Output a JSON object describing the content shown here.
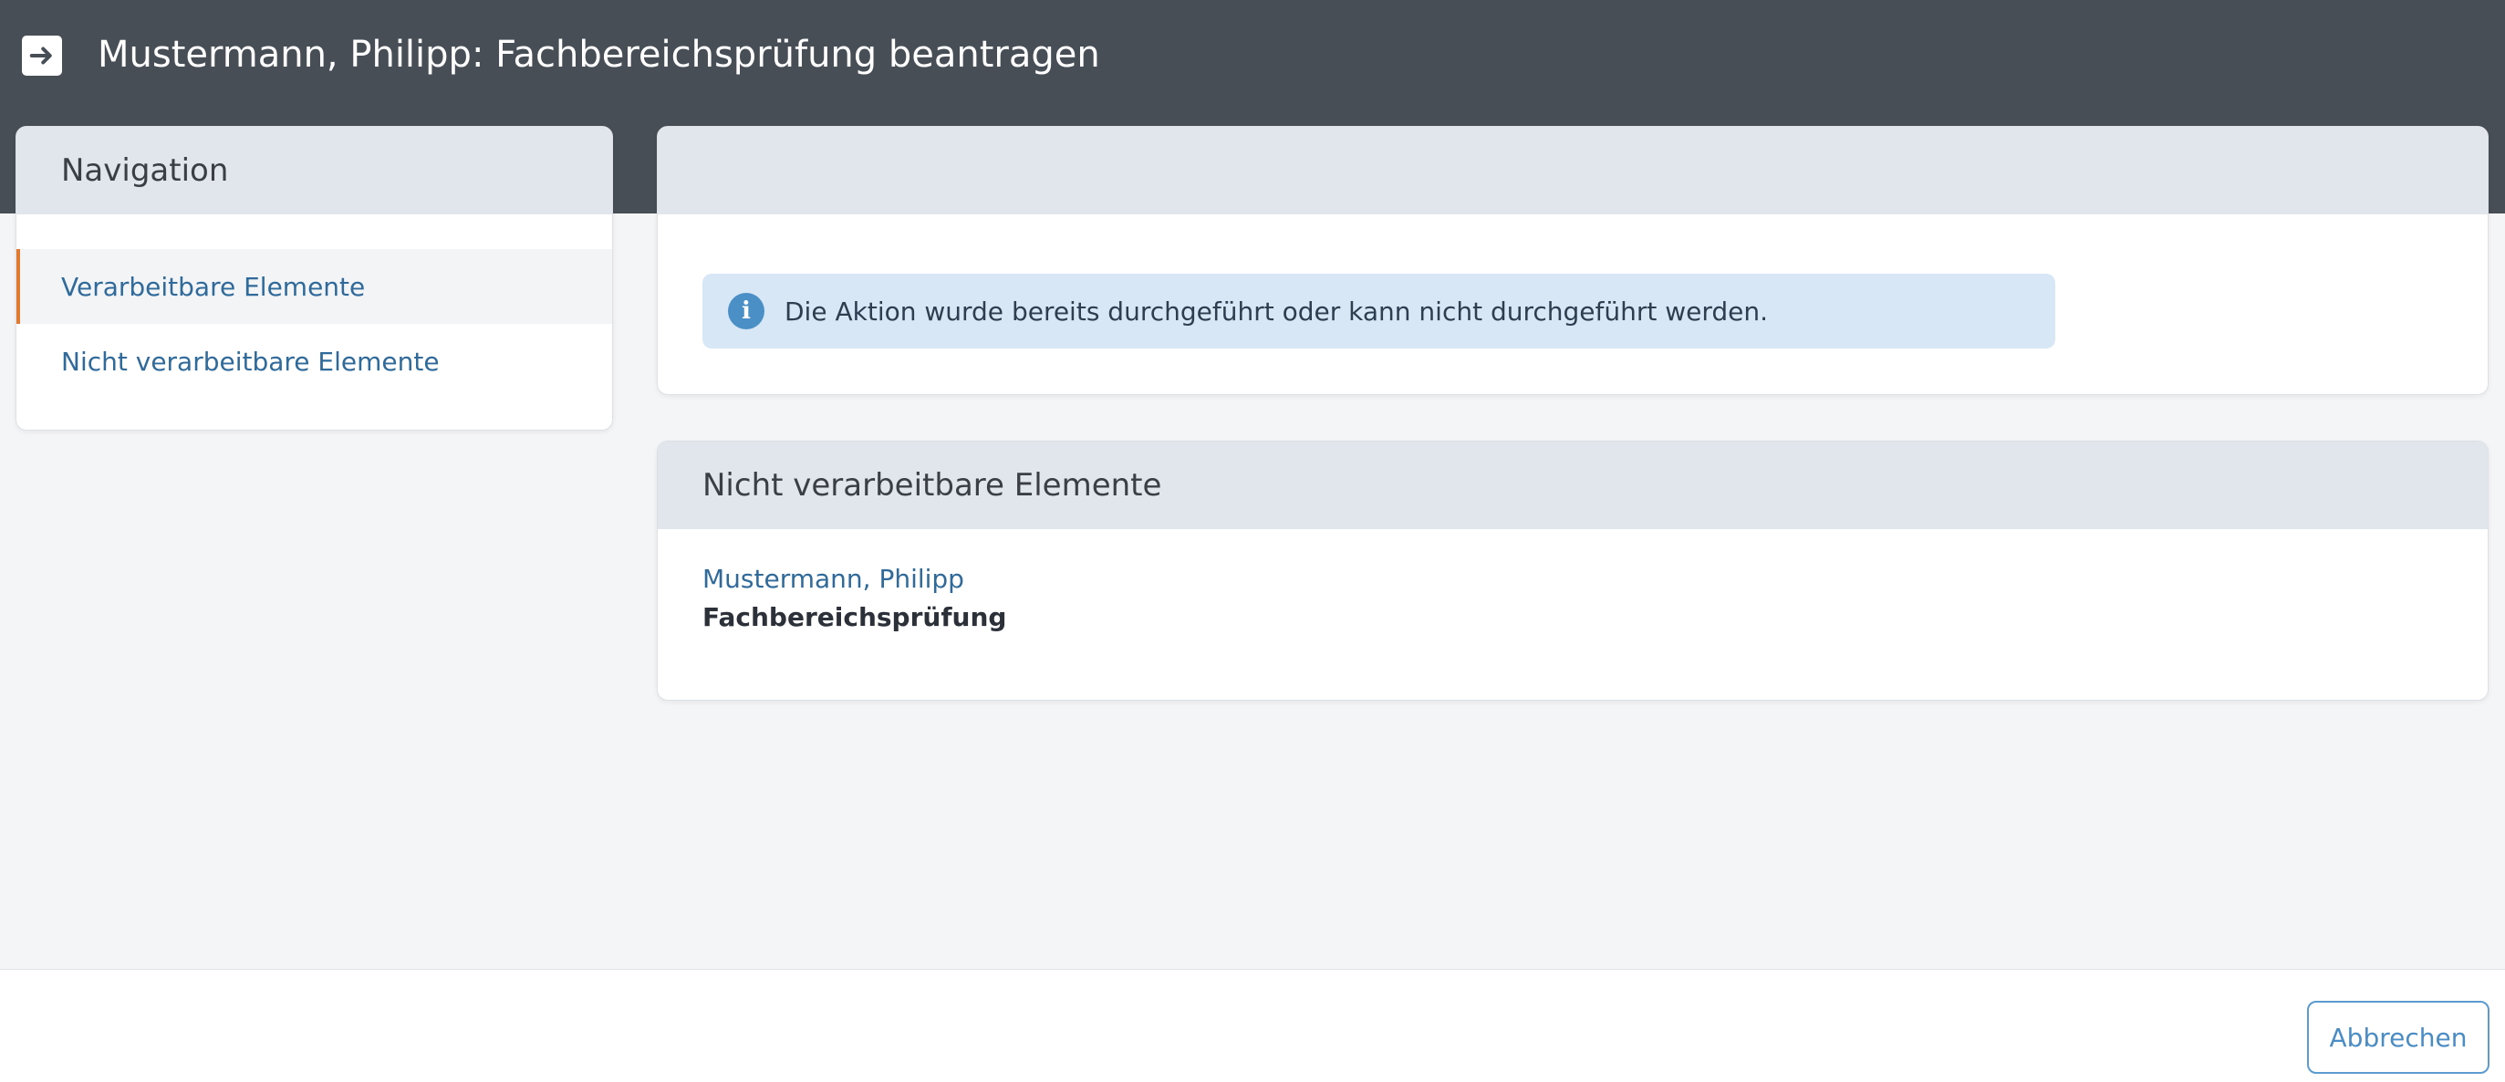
{
  "header": {
    "title": "Mustermann, Philipp: Fachbereichsprüfung beantragen",
    "icon": "arrow-right-icon"
  },
  "navigation": {
    "heading": "Navigation",
    "items": [
      {
        "label": "Verarbeitbare Elemente",
        "active": true
      },
      {
        "label": "Nicht verarbeitbare Elemente",
        "active": false
      }
    ]
  },
  "action_panel": {
    "heading": "",
    "alert": {
      "icon": "info-icon",
      "text": "Die Aktion wurde bereits durchgeführt oder kann nicht durchgeführt werden."
    }
  },
  "non_processable": {
    "heading": "Nicht verarbeitbare Elemente",
    "items": [
      {
        "name": "Mustermann, Philipp",
        "type": "Fachbereichsprüfung"
      }
    ]
  },
  "footer": {
    "cancel_label": "Abbrechen"
  },
  "colors": {
    "topbar": "#474e56",
    "accent": "#e07a33",
    "link": "#2f6a9a",
    "alert_bg": "#d8e7f5"
  }
}
